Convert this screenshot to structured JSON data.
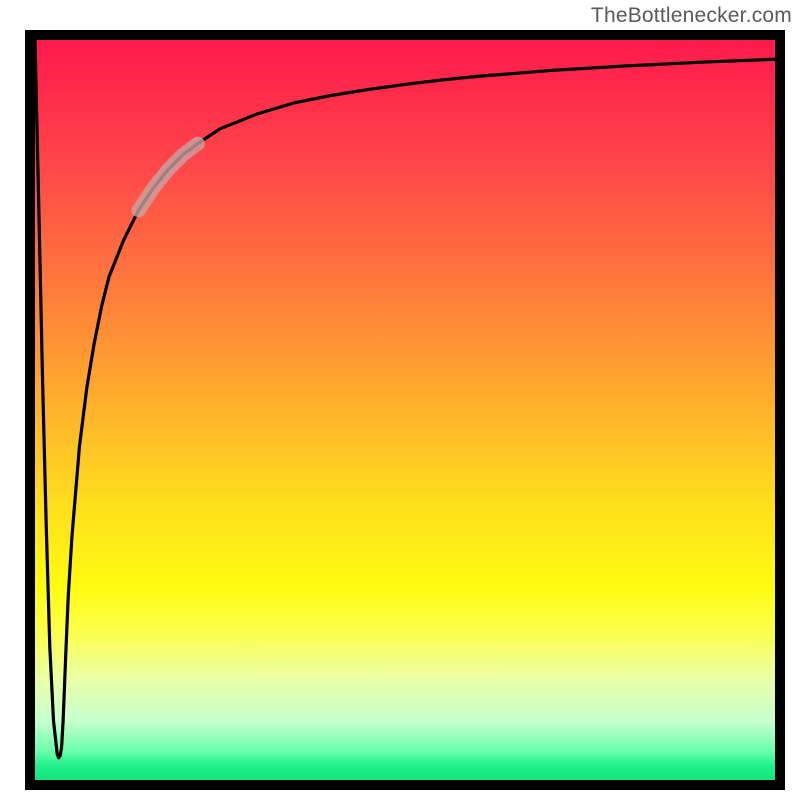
{
  "attribution": "TheBottlenecker.com",
  "chart_data": {
    "type": "line",
    "title": "",
    "xlabel": "",
    "ylabel": "",
    "xlim": [
      0,
      100
    ],
    "ylim": [
      0,
      100
    ],
    "series": [
      {
        "name": "curve",
        "x": [
          0,
          0.5,
          1,
          1.5,
          2,
          2.5,
          3,
          3.2,
          3.4,
          3.6,
          3.8,
          4,
          4.2,
          4.5,
          5,
          6,
          7,
          8,
          9,
          10,
          12,
          14,
          16,
          18,
          20,
          22,
          25,
          30,
          35,
          40,
          45,
          50,
          55,
          60,
          70,
          80,
          90,
          100
        ],
        "y": [
          100,
          78,
          55,
          35,
          18,
          8,
          3.5,
          3,
          3.3,
          4.5,
          8,
          13,
          18,
          25,
          33,
          45,
          53,
          59,
          64,
          68,
          73,
          77,
          80,
          82.5,
          84.5,
          86,
          88,
          90,
          91.5,
          92.5,
          93.3,
          94,
          94.6,
          95.1,
          95.9,
          96.5,
          97,
          97.4
        ]
      }
    ],
    "highlight_segment": {
      "x_start": 14,
      "x_end": 22
    },
    "background_gradient": {
      "direction": "vertical",
      "stops": [
        {
          "pos": 0.0,
          "color": "#ff1a4d"
        },
        {
          "pos": 0.3,
          "color": "#ff6f3f"
        },
        {
          "pos": 0.53,
          "color": "#ffbd28"
        },
        {
          "pos": 0.74,
          "color": "#fffb10"
        },
        {
          "pos": 0.92,
          "color": "#c7ffcf"
        },
        {
          "pos": 1.0,
          "color": "#10e77e"
        }
      ]
    }
  }
}
